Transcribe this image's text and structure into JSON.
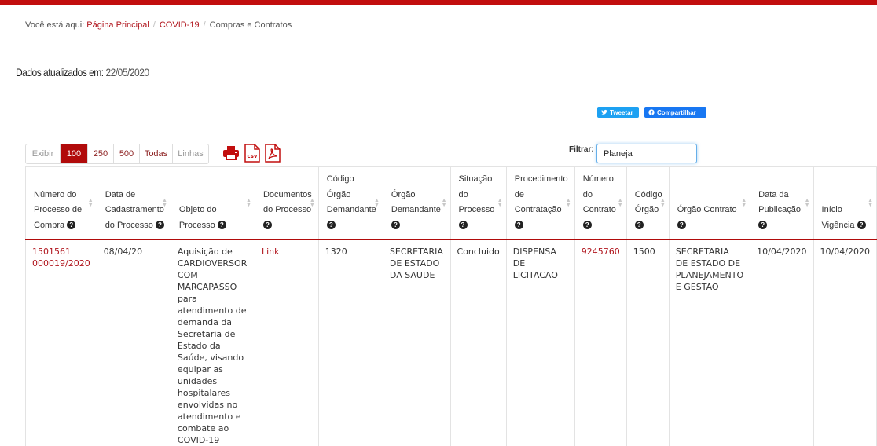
{
  "breadcrumb": {
    "prefix": "Você está aqui:",
    "items": [
      "Página Principal",
      "COVID-19",
      "Compras e Contratos"
    ]
  },
  "updated": {
    "label": "Dados atualizados em:",
    "value": "22/05/2020"
  },
  "share": {
    "tweet": "Tweetar",
    "facebook": "Compartilhar"
  },
  "pager": {
    "show_label": "Exibir",
    "options": [
      "100",
      "250",
      "500",
      "Todas"
    ],
    "selected": "100",
    "lines_label": "Linhas"
  },
  "toolbar": {
    "print_icon": "printer-icon",
    "csv_icon": "csv-file-icon",
    "pdf_icon": "pdf-file-icon"
  },
  "filter": {
    "label": "Filtrar:",
    "value": "Planeja"
  },
  "table": {
    "columns": [
      "Número do Processo de Compra",
      "Data de Cadastramento do Processo",
      "Objeto do Processo",
      "Documentos do Processo",
      "Código Órgão Demandante",
      "Órgão Demandante",
      "Situação do Processo",
      "Procedimento de Contratação",
      "Número do Contrato",
      "Código Órgão",
      "Órgão Contrato",
      "Data da Publicação",
      "Início Vigência"
    ],
    "rows": [
      {
        "numero": "1501561 000019/2020",
        "data_cadastro": "08/04/20",
        "objeto": "Aquisição de CARDIOVERSOR COM MARCAPASSO para atendimento de demanda da Secretaria de Estado da Saúde, visando equipar as unidades hospitalares envolvidas no atendimento e combate ao COVID-19",
        "documentos": "Link",
        "codigo_demandante": "1320",
        "orgao_demandante": "SECRETARIA DE ESTADO DA SAUDE",
        "situacao": "Concluido",
        "procedimento": "DISPENSA DE LICITACAO",
        "numero_contrato": "9245760",
        "codigo_orgao": "1500",
        "orgao_contrato": "SECRETARIA DE ESTADO DE PLANEJAMENTO E GESTAO",
        "data_publicacao": "10/04/2020",
        "inicio_vigencia": "10/04/2020"
      }
    ]
  },
  "colors": {
    "brand_red": "#c20e0e",
    "link_red": "#b0141c",
    "tweet_blue": "#1da1f2",
    "facebook_blue": "#1877f2"
  }
}
